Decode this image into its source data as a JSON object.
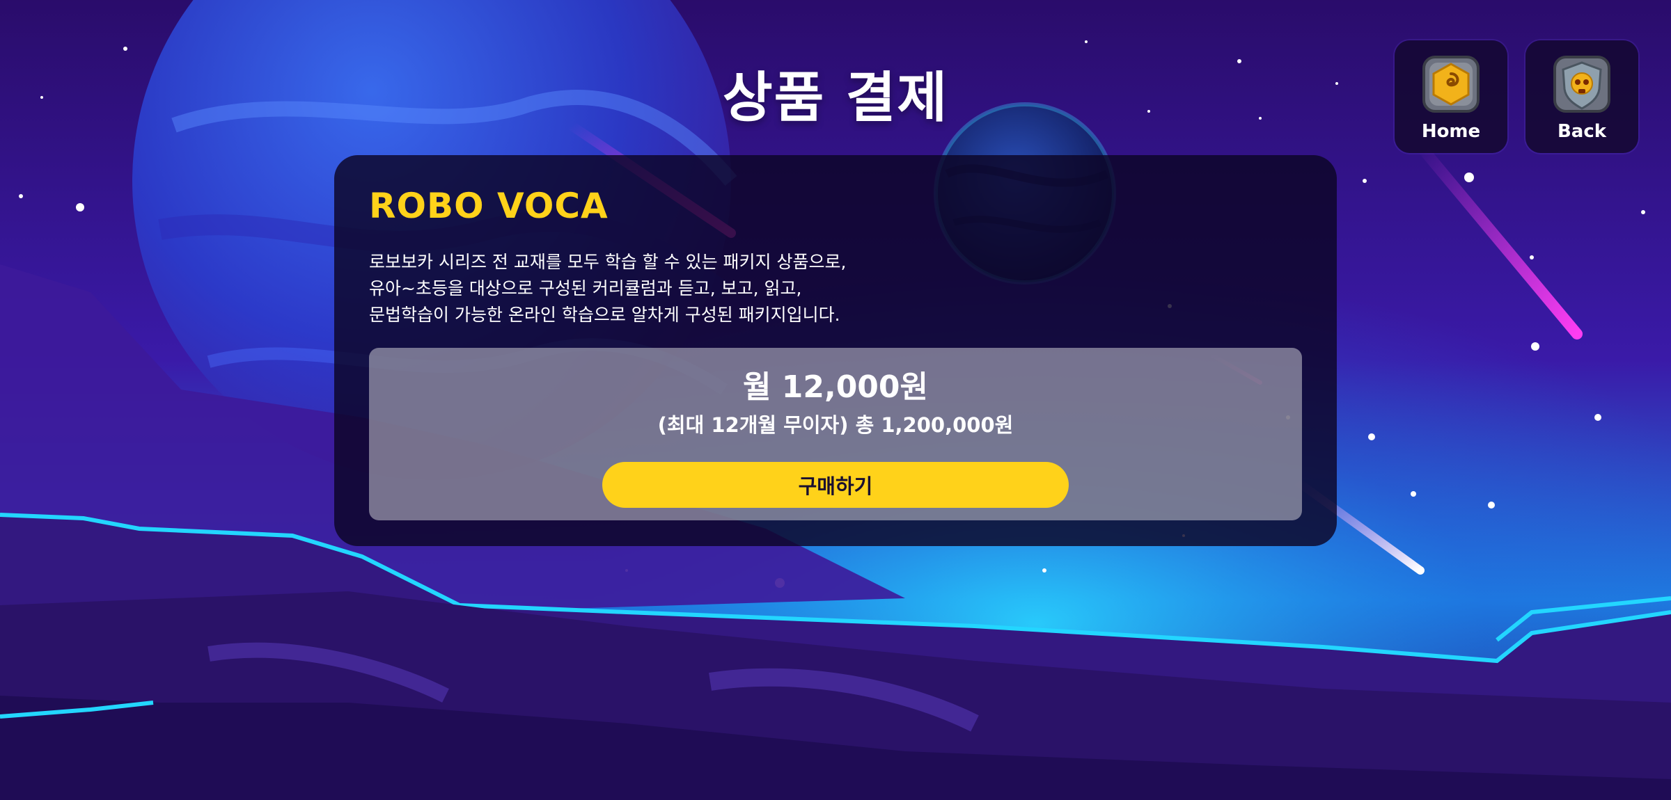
{
  "page": {
    "title": "상품 결제"
  },
  "nav": {
    "home": {
      "label": "Home",
      "icon": "gold-rune-icon"
    },
    "back": {
      "label": "Back",
      "icon": "skull-shield-icon"
    }
  },
  "product": {
    "name": "ROBO VOCA",
    "description": [
      "로보보카 시리즈 전 교재를 모두 학습 할 수 있는 패키지 상품으로,",
      "유아~초등을 대상으로 구성된 커리큘럼과 듣고, 보고, 읽고,",
      "문법학습이 가능한 온라인 학습으로 알차게 구성된 패키지입니다."
    ],
    "price_monthly": "월 12,000원",
    "price_total": "(최대 12개월 무이자) 총 1,200,000원",
    "buy_label": "구매하기"
  },
  "colors": {
    "accent_yellow": "#ffd21a",
    "card_bg": "#0c0526",
    "sky_top": "#2a0f6e",
    "sky_glow": "#1fb6ff",
    "meteor": "#ff3df2"
  }
}
